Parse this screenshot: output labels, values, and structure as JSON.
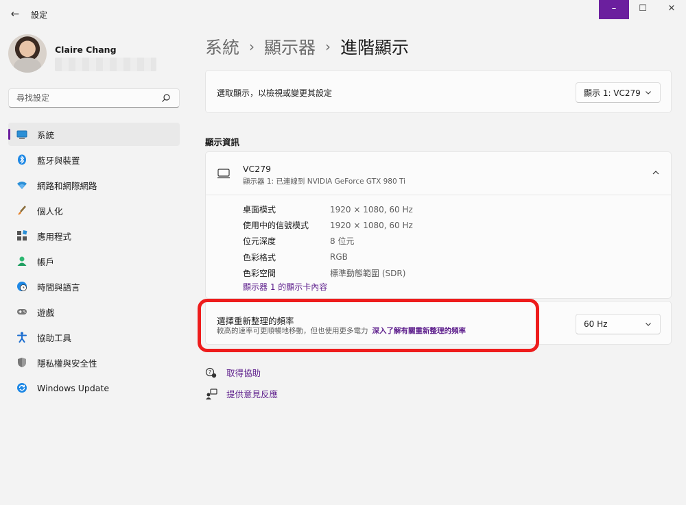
{
  "window": {
    "app_title": "設定",
    "back_glyph": "←",
    "minimize_glyph": "–",
    "maximize_glyph": "☐",
    "close_glyph": "✕"
  },
  "user": {
    "name": "Claire Chang"
  },
  "search": {
    "placeholder": "尋找設定"
  },
  "sidebar": {
    "items": [
      {
        "label": "系統",
        "icon": "monitor-icon",
        "active": true
      },
      {
        "label": "藍牙與裝置",
        "icon": "bluetooth-icon"
      },
      {
        "label": "網路和網際網路",
        "icon": "wifi-icon"
      },
      {
        "label": "個人化",
        "icon": "brush-icon"
      },
      {
        "label": "應用程式",
        "icon": "apps-icon"
      },
      {
        "label": "帳戶",
        "icon": "account-icon"
      },
      {
        "label": "時間與語言",
        "icon": "globe-clock-icon"
      },
      {
        "label": "遊戲",
        "icon": "gamepad-icon"
      },
      {
        "label": "協助工具",
        "icon": "accessibility-icon"
      },
      {
        "label": "隱私權與安全性",
        "icon": "shield-icon"
      },
      {
        "label": "Windows Update",
        "icon": "update-icon"
      }
    ]
  },
  "breadcrumb": {
    "level1": "系統",
    "level2": "顯示器",
    "current": "進階顯示",
    "separator": "›"
  },
  "select_display": {
    "label": "選取顯示，以檢視或變更其設定",
    "value": "顯示 1: VC279"
  },
  "display_info": {
    "section_title": "顯示資訊",
    "name": "VC279",
    "subtitle": "顯示器 1: 已連線到 NVIDIA GeForce GTX 980 Ti",
    "properties": [
      {
        "key": "桌面模式",
        "value": "1920 × 1080, 60 Hz"
      },
      {
        "key": "使用中的信號模式",
        "value": "1920 × 1080, 60 Hz"
      },
      {
        "key": "位元深度",
        "value": "8 位元"
      },
      {
        "key": "色彩格式",
        "value": "RGB"
      },
      {
        "key": "色彩空間",
        "value": "標準動態範圍 (SDR)"
      }
    ],
    "adapter_link": "顯示器 1 的顯示卡內容"
  },
  "refresh_rate": {
    "title": "選擇重新整理的頻率",
    "description": "較高的速率可更順暢地移動，但也使用更多電力",
    "learn_more": "深入了解有關重新整理的頻率",
    "value": "60 Hz"
  },
  "help": {
    "get_help": "取得協助",
    "feedback": "提供意見反應"
  },
  "colors": {
    "accent": "#6b1f9e",
    "link": "#5a1a8a",
    "highlight_box": "#ee1c1c"
  }
}
